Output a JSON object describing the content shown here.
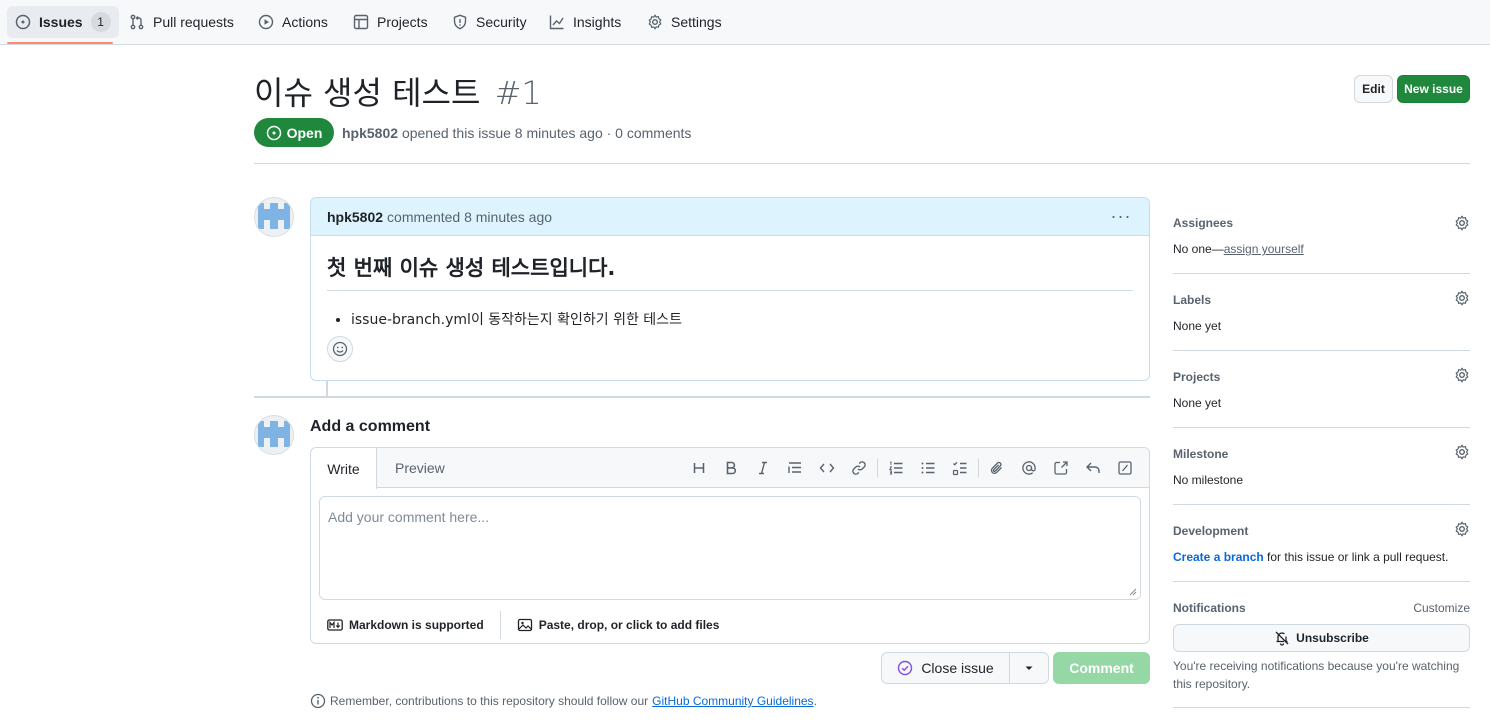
{
  "nav": {
    "items": [
      {
        "label": "Issues",
        "icon": "issue-opened-icon",
        "count": "1",
        "active": true
      },
      {
        "label": "Pull requests",
        "icon": "git-pull-request-icon"
      },
      {
        "label": "Actions",
        "icon": "play-icon"
      },
      {
        "label": "Projects",
        "icon": "table-icon"
      },
      {
        "label": "Security",
        "icon": "shield-icon"
      },
      {
        "label": "Insights",
        "icon": "graph-icon"
      },
      {
        "label": "Settings",
        "icon": "gear-icon"
      }
    ],
    "accent": "#fd8c73"
  },
  "issue": {
    "title": "이슈 생성 테스트",
    "number": "#1",
    "state": "Open",
    "author": "hpk5802",
    "meta_text": "opened this issue 8 minutes ago · 0 comments",
    "edit_label": "Edit",
    "new_issue_label": "New issue",
    "state_color": "#1f883d"
  },
  "comment": {
    "author": "hpk5802",
    "meta": "commented 8 minutes ago",
    "heading": "첫 번째 이슈 생성 테스트입니다.",
    "bullets": [
      "issue-branch.yml이 동작하는지 확인하기 위한 테스트"
    ],
    "header_color": "#ddf4ff"
  },
  "composer": {
    "title": "Add a comment",
    "tab_write": "Write",
    "tab_preview": "Preview",
    "placeholder": "Add your comment here...",
    "markdown_note": "Markdown is supported",
    "attach_note": "Paste, drop, or click to add files",
    "close_issue_label": "Close issue",
    "comment_label": "Comment",
    "guidelines_prefix": "Remember, contributions to this repository should follow our",
    "guidelines_link": "GitHub Community Guidelines",
    "guidelines_suffix": "."
  },
  "sidebar": {
    "assignees": {
      "label": "Assignees",
      "value_prefix": "No one—",
      "value_link": "assign yourself"
    },
    "labels": {
      "label": "Labels",
      "value": "None yet"
    },
    "projects": {
      "label": "Projects",
      "value": "None yet"
    },
    "milestone": {
      "label": "Milestone",
      "value": "No milestone"
    },
    "development": {
      "label": "Development",
      "value_link": "Create a branch",
      "value_suffix": " for this issue or link a pull request."
    },
    "notifications": {
      "label": "Notifications",
      "customize": "Customize",
      "unsubscribe": "Unsubscribe",
      "note": "You're receiving notifications because you're watching this repository."
    }
  }
}
